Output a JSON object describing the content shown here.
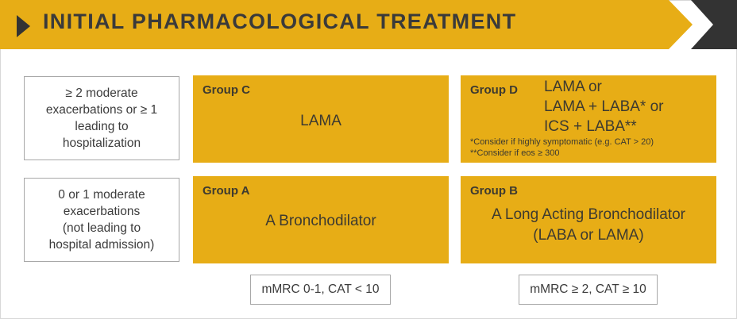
{
  "title": "INITIAL PHARMACOLOGICAL TREATMENT",
  "rows": [
    {
      "lines": [
        "≥ 2 moderate",
        "exacerbations or ≥ 1",
        "leading to",
        "hospitalization"
      ]
    },
    {
      "lines": [
        "0 or 1 moderate",
        "exacerbations",
        "(not leading to",
        "hospital admission)"
      ]
    }
  ],
  "groups": {
    "c": {
      "title": "Group C",
      "lines": [
        "LAMA"
      ]
    },
    "d": {
      "title": "Group D",
      "lines": [
        "LAMA  or",
        "LAMA + LABA* or",
        "ICS + LABA**"
      ],
      "footnotes": [
        "*Consider if highly symptomatic (e.g. CAT > 20)",
        "**Consider if eos ≥ 300"
      ]
    },
    "a": {
      "title": "Group A",
      "lines": [
        "A Bronchodilator"
      ]
    },
    "b": {
      "title": "Group B",
      "lines": [
        "A  Long Acting Bronchodilator",
        "(LABA or LAMA)"
      ]
    }
  },
  "columns": [
    "mMRC 0-1, CAT < 10",
    "mMRC ≥ 2, CAT ≥ 10"
  ],
  "colors": {
    "gold": "#e7ad16",
    "dark": "#333333",
    "text": "#3b3b3b"
  },
  "icons": {
    "banner_arrow": "chevron-arrow-icon"
  }
}
